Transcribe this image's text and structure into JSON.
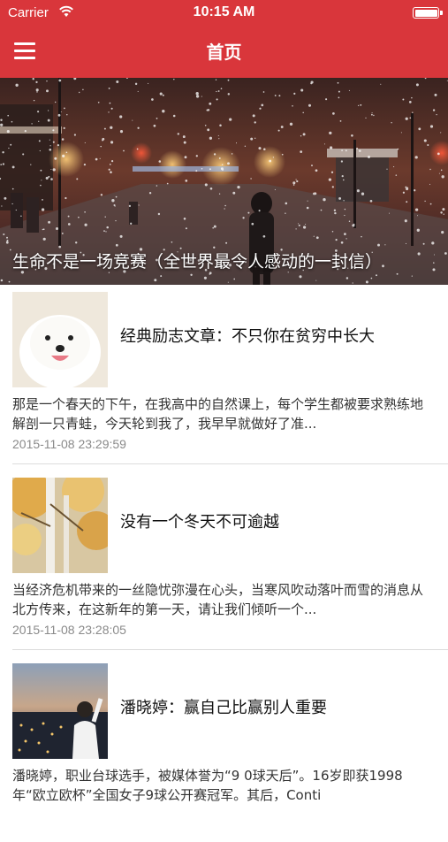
{
  "status_bar": {
    "carrier": "Carrier",
    "time": "10:15 AM",
    "battery_level": 1.0
  },
  "nav": {
    "title": "首页",
    "menu_icon": "hamburger-menu-icon"
  },
  "banner": {
    "title": "生命不是一场竞赛（全世界最令人感动的一封信）"
  },
  "articles": [
    {
      "title": "经典励志文章：不只你在贫穷中长大",
      "summary": "那是一个春天的下午，在我高中的自然课上，每个学生都被要求熟练地解剖一只青蛙，今天轮到我了，我早早就做好了准...",
      "date": "2015-11-08 23:29:59"
    },
    {
      "title": "没有一个冬天不可逾越",
      "summary": "当经济危机带来的一丝隐忧弥漫在心头，当寒风吹动落叶而雪的消息从北方传来，在这新年的第一天，请让我们倾听一个...",
      "date": "2015-11-08 23:28:05"
    },
    {
      "title": "潘晓婷：赢自己比赢别人重要",
      "summary": "潘晓婷，职业台球选手，被媒体誉为“9 0球天后”。16岁即获1998年“欧立欧杯”全国女子9球公开赛冠军。其后，Conti",
      "date": ""
    }
  ],
  "colors": {
    "accent": "#d9363b",
    "separator": "#dcdcdc",
    "date_text": "#8a8a8a"
  }
}
